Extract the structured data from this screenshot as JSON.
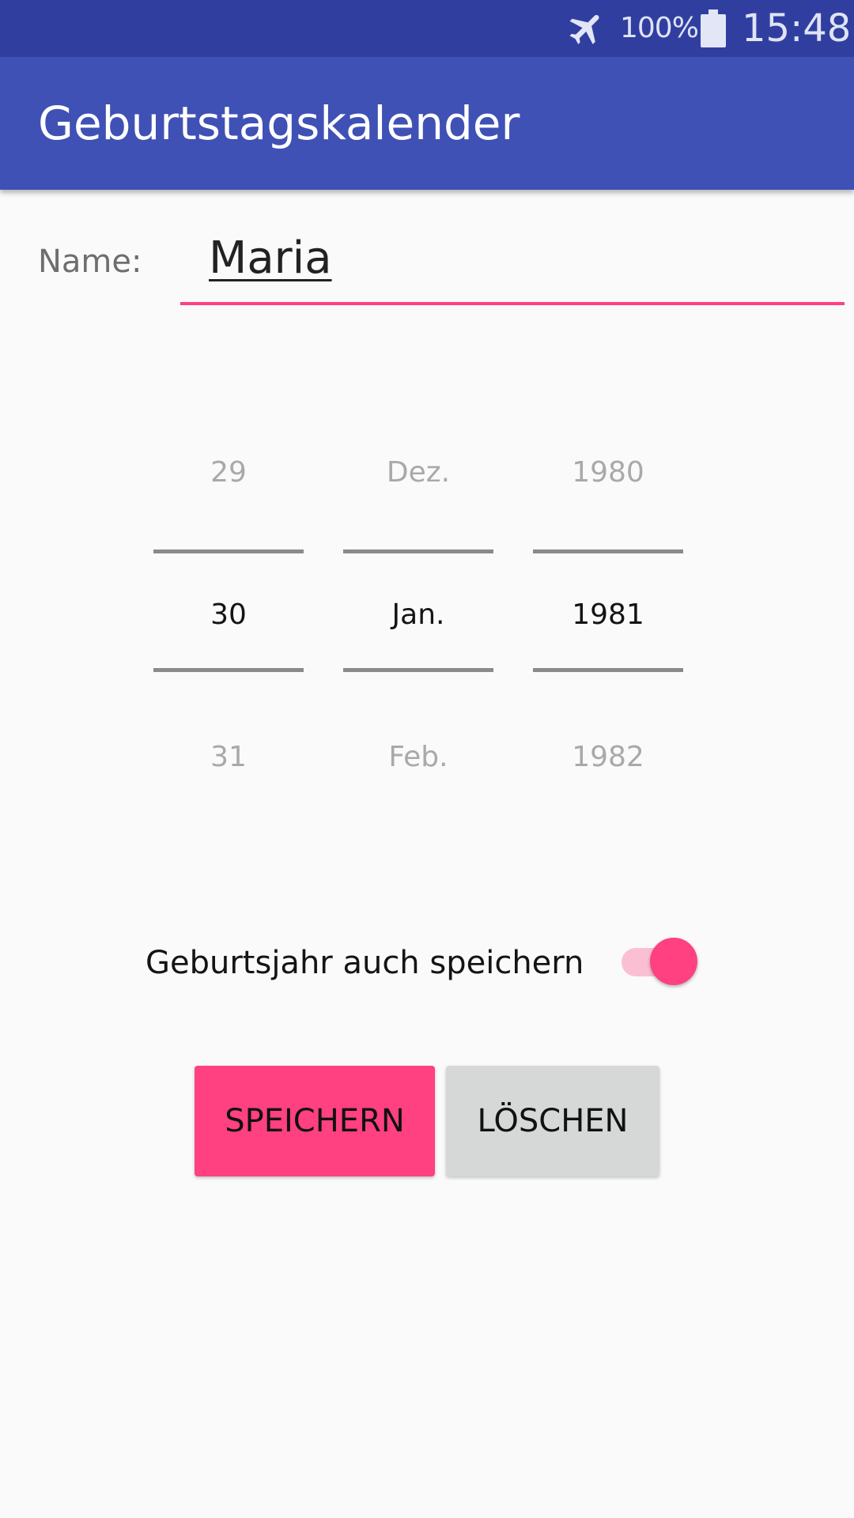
{
  "status_bar": {
    "battery_percent": "100%",
    "time": "15:48",
    "icons": [
      "airplane-mode-icon",
      "battery-icon"
    ]
  },
  "app_bar": {
    "title": "Geburtstagskalender"
  },
  "form": {
    "name_label": "Name:",
    "name_value": "Maria",
    "accent_color": "#ff4081",
    "primary_color": "#3f51b5",
    "primary_dark_color": "#303f9f"
  },
  "date_picker": {
    "day": {
      "prev": "29",
      "current": "30",
      "next": "31"
    },
    "month": {
      "prev": "Dez.",
      "current": "Jan.",
      "next": "Feb."
    },
    "year": {
      "prev": "1980",
      "current": "1981",
      "next": "1982"
    }
  },
  "save_year_toggle": {
    "label": "Geburtsjahr auch speichern",
    "checked": true
  },
  "buttons": {
    "save_label": "SPEICHERN",
    "delete_label": "LÖSCHEN"
  }
}
